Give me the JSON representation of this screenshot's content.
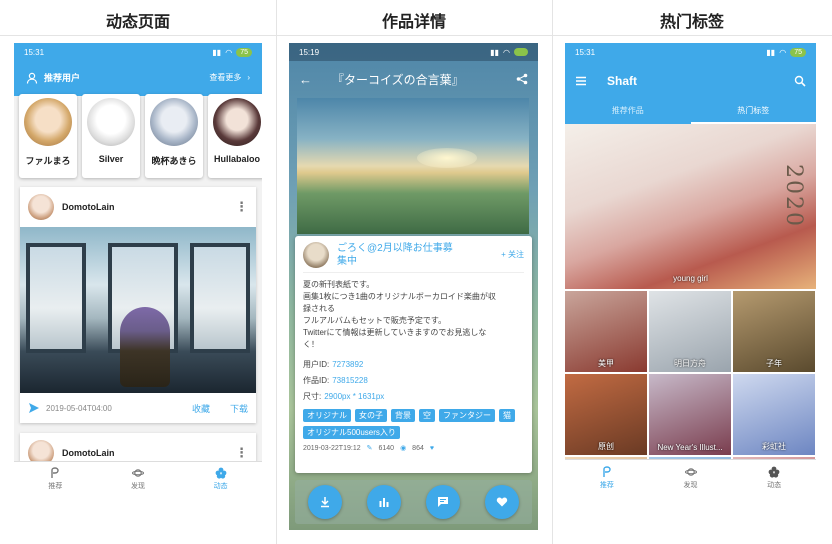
{
  "columns": [
    {
      "title": "动态页面"
    },
    {
      "title": "作品详情"
    },
    {
      "title": "热门标签"
    }
  ],
  "phone1": {
    "time": "15:31",
    "battery": "75",
    "recommended_users_label": "推荐用户",
    "see_more_label": "查看更多",
    "users": [
      {
        "name": "ファルまろ"
      },
      {
        "name": "Silver"
      },
      {
        "name": "晩杯あきら"
      },
      {
        "name": "Hullabaloo"
      }
    ],
    "posts": [
      {
        "author": "DomotoLain",
        "date": "2019-05-04T04:00",
        "collect": "收藏",
        "download": "下载"
      },
      {
        "author": "DomotoLain"
      }
    ],
    "nav": [
      {
        "label": "推荐"
      },
      {
        "label": "发现"
      },
      {
        "label": "动态"
      }
    ]
  },
  "phone2": {
    "time": "15:19",
    "title": "『ターコイズの合言葉』",
    "author": "ごろく@2月以降お仕事募集中",
    "follow_label": "+ 关注",
    "description": [
      "夏の新刊表紙です。",
      "画集1枚につき1曲のオリジナルボーカロイド楽曲が収",
      "録される",
      "フルアルバムもセットで販売予定です。",
      "Twitterにて情報は更新していきますのでお見逃しな",
      "く！"
    ],
    "user_id_label": "用户ID:",
    "user_id": "7273892",
    "work_id_label": "作品ID:",
    "work_id": "73815228",
    "size_label": "尺寸:",
    "size": "2900px * 1631px",
    "tags": [
      "オリジナル",
      "女の子",
      "背景",
      "空",
      "ファンタジー",
      "猫",
      "オリジナル500users入り"
    ],
    "date": "2019-03-22T19:12",
    "views": "6140",
    "likes": "864"
  },
  "phone3": {
    "time": "15:31",
    "battery": "75",
    "app_title": "Shaft",
    "tabs": [
      {
        "label": "推荐作品"
      },
      {
        "label": "热门标签"
      }
    ],
    "featured_tag": "young girl",
    "featured_year": "2020",
    "tag_grid": [
      {
        "label": "美甲",
        "c1": "#c9a59b",
        "c2": "#8a3a30"
      },
      {
        "label": "明日方舟",
        "c1": "#dfe3e6",
        "c2": "#9aa4ad"
      },
      {
        "label": "子年",
        "c1": "#b59a6f",
        "c2": "#5a4a2e"
      },
      {
        "label": "原创",
        "c1": "#c26b43",
        "c2": "#6a3a24"
      },
      {
        "label": "New Year's Illust...",
        "c1": "#c7b9c9",
        "c2": "#7a3d4e"
      },
      {
        "label": "彩虹社",
        "c1": "#cfd9ef",
        "c2": "#6d86c2"
      },
      {
        "label": "",
        "c1": "#f1d8b8",
        "c2": "#b88a5c"
      },
      {
        "label": "",
        "c1": "#a9cbe9",
        "c2": "#5a8fc9"
      },
      {
        "label": "",
        "c1": "#e0b7b9",
        "c2": "#b84a4e"
      }
    ],
    "nav": [
      {
        "label": "推荐"
      },
      {
        "label": "发现"
      },
      {
        "label": "动态"
      }
    ]
  }
}
